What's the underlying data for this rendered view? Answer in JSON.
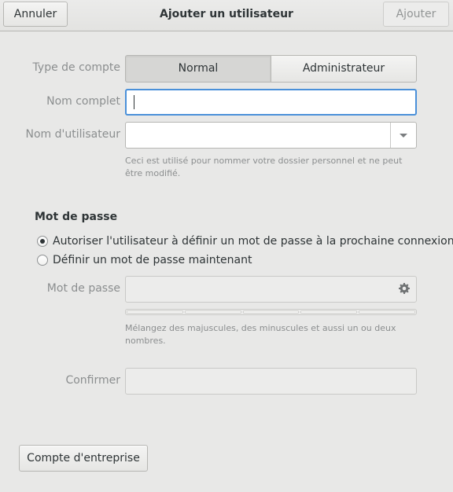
{
  "header": {
    "title": "Ajouter un utilisateur",
    "cancel_label": "Annuler",
    "add_label": "Ajouter"
  },
  "form": {
    "account_type_label": "Type de compte",
    "account_types": [
      "Normal",
      "Administrateur"
    ],
    "selected_account_type": "Normal",
    "full_name_label": "Nom complet",
    "full_name_value": "",
    "username_label": "Nom d'utilisateur",
    "username_value": "",
    "username_hint": "Ceci est utilisé pour nommer votre dossier personnel et ne peut être modifié."
  },
  "password": {
    "section_title": "Mot de passe",
    "option_later": "Autoriser l'utilisateur à définir un mot de passe à la prochaine connexion",
    "option_now": "Définir un mot de passe maintenant",
    "selected_option": "later",
    "password_label": "Mot de passe",
    "password_value": "",
    "strength_segments": 5,
    "strength_level": 0,
    "hint": "Mélangez des majuscules, des minuscules et aussi un ou deux nombres.",
    "confirm_label": "Confirmer",
    "confirm_value": ""
  },
  "footer": {
    "enterprise_label": "Compte d'entreprise"
  },
  "colors": {
    "focus_border": "#4a90d9",
    "background": "#e8e8e7",
    "label_text": "#8b8e8f"
  },
  "icons": {
    "generate_password": "gear-icon",
    "combo": "chevron-down-icon"
  }
}
